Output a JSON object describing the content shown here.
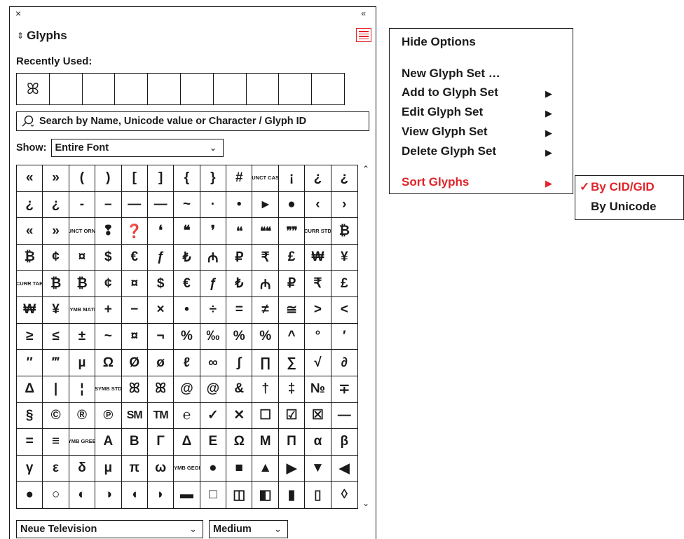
{
  "panel": {
    "close_icon": "×",
    "collapse_icon": "«",
    "title": "Glyphs",
    "recent_label": "Recently Used:",
    "recent_glyphs": [
      "ꕤ",
      "",
      "",
      "",
      "",
      "",
      "",
      "",
      "",
      ""
    ],
    "search_placeholder": "Search by Name, Unicode value or Character / Glyph ID",
    "show_label": "Show:",
    "show_value": "Entire Font",
    "font_family": "Neue Television",
    "font_style": "Medium",
    "accent_color": "#e0242a"
  },
  "glyph_grid": [
    [
      "«",
      "»",
      "(",
      ")",
      "[",
      "]",
      "{",
      "}",
      "#",
      "PUNCT CASE",
      "¡",
      "¿",
      "¿"
    ],
    [
      "¿",
      "¿",
      "-",
      "–",
      "—",
      "—",
      "~",
      "·",
      "•",
      "▸",
      "●",
      "‹",
      "›"
    ],
    [
      "«",
      "»",
      "PUNCT ORNM",
      "❢",
      "❓",
      "❛",
      "❝",
      "❜",
      "❛❛",
      "❝❝",
      "❞❞",
      "CURR STD",
      "₿"
    ],
    [
      "₿",
      "¢",
      "¤",
      "$",
      "€",
      "ƒ",
      "₺",
      "₼",
      "₽",
      "₹",
      "£",
      "₩",
      "¥"
    ],
    [
      "CURR TAB",
      "₿",
      "₿",
      "¢",
      "¤",
      "$",
      "€",
      "ƒ",
      "₺",
      "₼",
      "₽",
      "₹",
      "£"
    ],
    [
      "₩",
      "¥",
      "SYMB MATH",
      "+",
      "−",
      "×",
      "•",
      "÷",
      "=",
      "≠",
      "≅",
      ">",
      "<"
    ],
    [
      "≥",
      "≤",
      "±",
      "~",
      "¤",
      "¬",
      "%",
      "‰",
      "%",
      "%",
      "^",
      "°",
      "′"
    ],
    [
      "″",
      "‴",
      "µ",
      "Ω",
      "Ø",
      "ø",
      "ℓ",
      "∞",
      "∫",
      "∏",
      "∑",
      "√",
      "∂"
    ],
    [
      "Δ",
      "|",
      "¦",
      "SYMB STD",
      "ꕤ",
      "ꕤ",
      "@",
      "@",
      "&",
      "†",
      "‡",
      "№",
      "∓"
    ],
    [
      "§",
      "©",
      "®",
      "℗",
      "SM",
      "TM",
      "℮",
      "✓",
      "✕",
      "☐",
      "☑",
      "☒",
      "—"
    ],
    [
      "=",
      "≡",
      "SYMB GREEK",
      "Α",
      "Β",
      "Γ",
      "Δ",
      "Ε",
      "Ω",
      "Μ",
      "Π",
      "α",
      "β"
    ],
    [
      "γ",
      "ε",
      "δ",
      "μ",
      "π",
      "ω",
      "SYMB GEOM",
      "●",
      "■",
      "▲",
      "▶",
      "▼",
      "◀"
    ],
    [
      "●",
      "○",
      "◐",
      "◑",
      "◖",
      "◗",
      "▬",
      "□",
      "◫",
      "◧",
      "▮",
      "▯",
      "◊"
    ]
  ],
  "context_menu": {
    "hide_options": "Hide Options",
    "new_glyph_set": "New Glyph Set …",
    "add_to_glyph_set": "Add to Glyph Set",
    "edit_glyph_set": "Edit Glyph Set",
    "view_glyph_set": "View Glyph Set",
    "delete_glyph_set": "Delete Glyph Set",
    "sort_glyphs": "Sort Glyphs",
    "arrow": "▶"
  },
  "sort_submenu": {
    "check": "✓",
    "by_cid": "By CID/GID",
    "by_unicode": "By Unicode"
  }
}
